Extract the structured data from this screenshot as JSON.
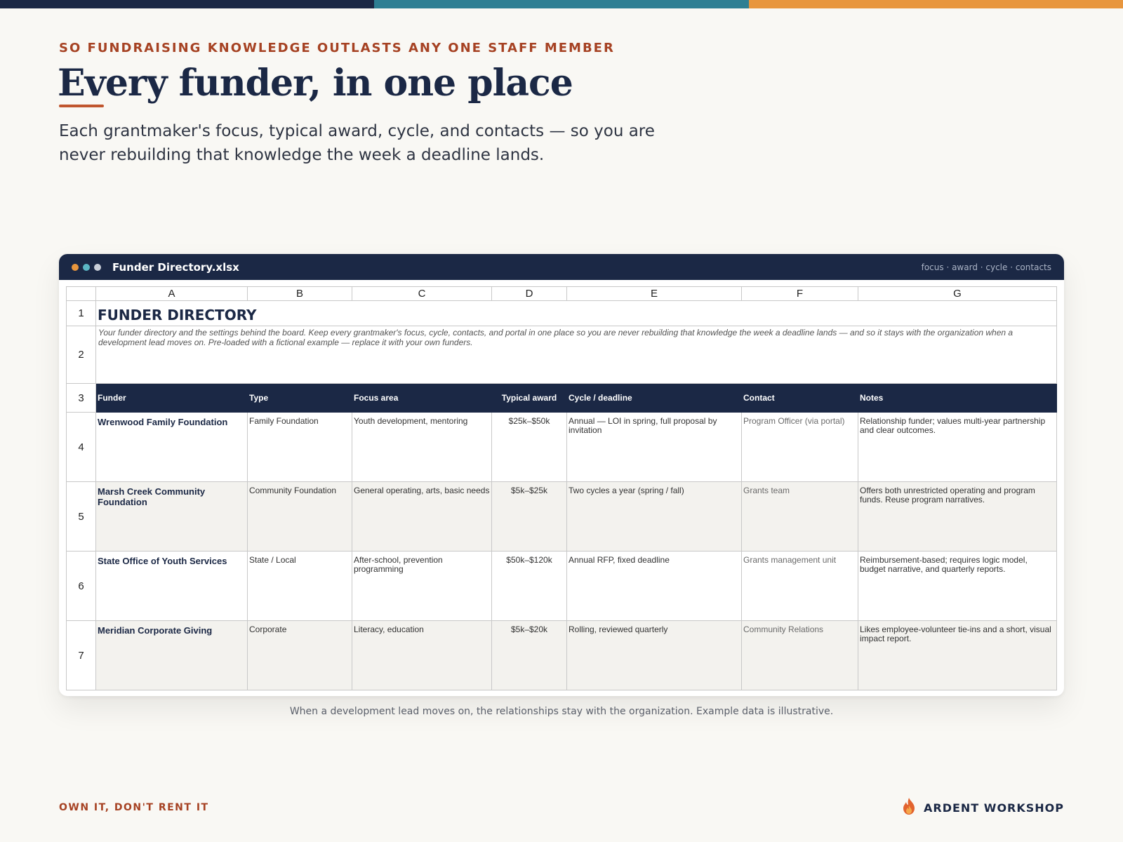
{
  "colors": {
    "navy": "#1b2845",
    "teal": "#2e7f93",
    "orange": "#e8963d",
    "rust": "#a64223",
    "accent_rule": "#c0562e"
  },
  "header": {
    "eyebrow": "SO FUNDRAISING KNOWLEDGE OUTLASTS ANY ONE STAFF MEMBER",
    "title": "Every funder, in one place",
    "lede": "Each grantmaker's focus, typical award, cycle, and contacts — so you are never rebuilding that knowledge the week a deadline lands."
  },
  "window": {
    "filename": "Funder Directory.xlsx",
    "tag": "focus · award · cycle · contacts",
    "dot_colors": [
      "#e8963d",
      "#5bb6c4",
      "#c9ced8"
    ]
  },
  "sheet": {
    "column_letters": [
      "A",
      "B",
      "C",
      "D",
      "E",
      "F",
      "G"
    ],
    "row_numbers": [
      "1",
      "2",
      "3",
      "4",
      "5",
      "6",
      "7"
    ],
    "title": "FUNDER DIRECTORY",
    "description": "Your funder directory and the settings behind the board. Keep every grantmaker's focus, cycle, contacts, and portal in one place so you are never rebuilding that knowledge the week a deadline lands — and so it stays with the organization when a development lead moves on. Pre-loaded with a fictional example — replace it with your own funders.",
    "headers": [
      "Funder",
      "Type",
      "Focus area",
      "Typical award",
      "Cycle / deadline",
      "Contact",
      "Notes"
    ],
    "rows": [
      {
        "funder": "Wrenwood Family Foundation",
        "type": "Family Foundation",
        "focus": "Youth development, mentoring",
        "award": "$25k–$50k",
        "cycle": "Annual — LOI in spring, full proposal by invitation",
        "contact": "Program Officer (via portal)",
        "notes": "Relationship funder; values multi-year partnership and clear outcomes."
      },
      {
        "funder": "Marsh Creek Community Foundation",
        "type": "Community Foundation",
        "focus": "General operating, arts, basic needs",
        "award": "$5k–$25k",
        "cycle": "Two cycles a year (spring / fall)",
        "contact": "Grants team",
        "notes": "Offers both unrestricted operating and program funds. Reuse program narratives."
      },
      {
        "funder": "State Office of Youth Services",
        "type": "State / Local",
        "focus": "After-school, prevention programming",
        "award": "$50k–$120k",
        "cycle": "Annual RFP, fixed deadline",
        "contact": "Grants management unit",
        "notes": "Reimbursement-based; requires logic model, budget narrative, and quarterly reports."
      },
      {
        "funder": "Meridian Corporate Giving",
        "type": "Corporate",
        "focus": "Literacy, education",
        "award": "$5k–$20k",
        "cycle": "Rolling, reviewed quarterly",
        "contact": "Community Relations",
        "notes": "Likes employee-volunteer tie-ins and a short, visual impact report."
      }
    ]
  },
  "caption": "When a development lead moves on, the relationships stay with the organization. Example data is illustrative.",
  "footer": {
    "tagline": "OWN IT, DON'T RENT IT",
    "brand": "ARDENT WORKSHOP",
    "brand_icon": "flame-icon"
  }
}
